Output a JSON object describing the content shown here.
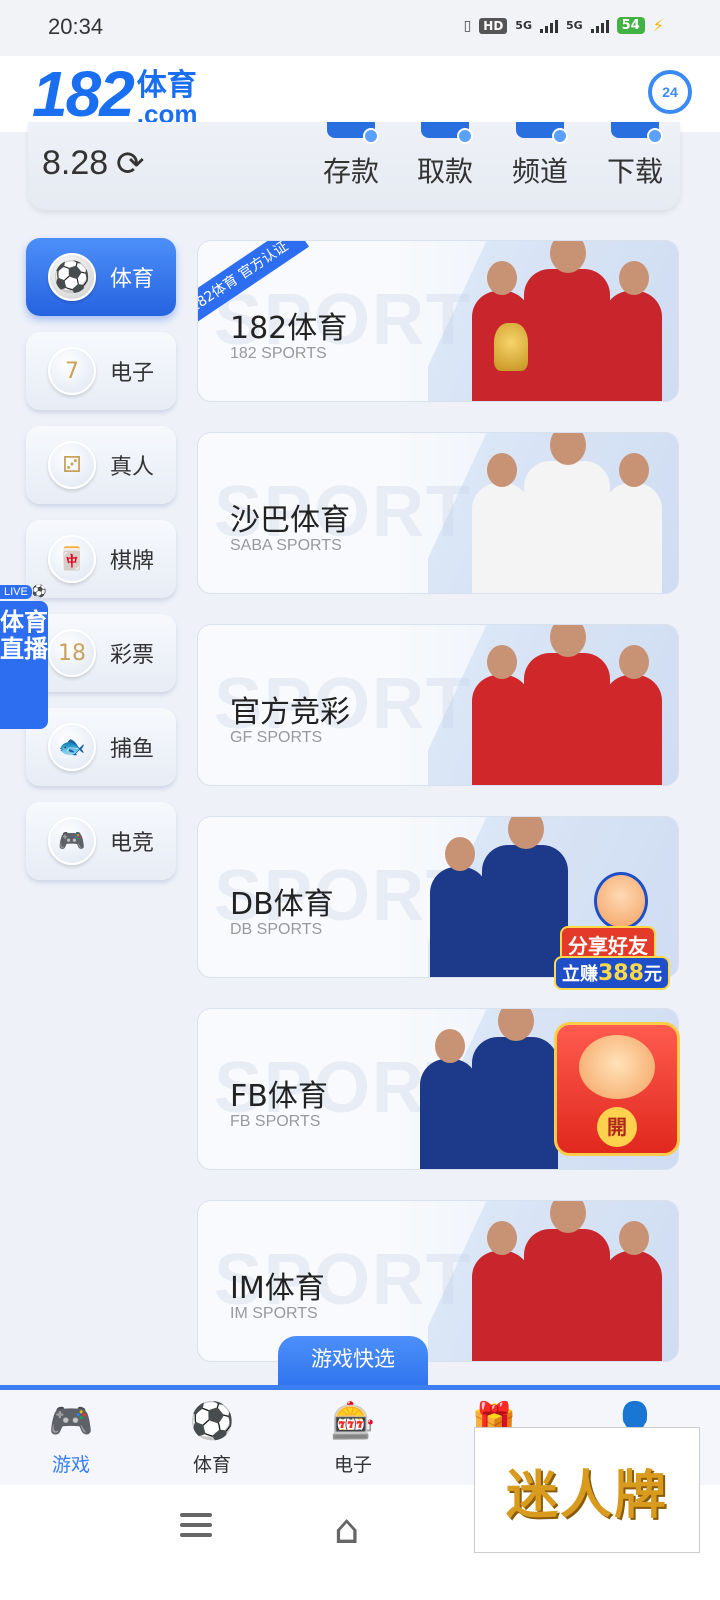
{
  "status_bar": {
    "time": "20:34",
    "hd": "HD",
    "sig1": "5G",
    "sig2": "5G",
    "battery": "54"
  },
  "header": {
    "logo_number": "182",
    "logo_text": "体育",
    "logo_domain": ".com",
    "support_label": "24"
  },
  "wallet": {
    "balance": "8.28",
    "actions": [
      {
        "label": "存款",
        "icon": "deposit-icon"
      },
      {
        "label": "取款",
        "icon": "withdraw-icon"
      },
      {
        "label": "频道",
        "icon": "channel-icon"
      },
      {
        "label": "下载",
        "icon": "download-icon"
      }
    ]
  },
  "categories": [
    {
      "label": "体育",
      "icon": "soccer-ball-icon",
      "glyph": "⚽",
      "active": true
    },
    {
      "label": "电子",
      "icon": "slot-machine-icon",
      "glyph": "7",
      "active": false
    },
    {
      "label": "真人",
      "icon": "dice-icon",
      "glyph": "⚂",
      "active": false
    },
    {
      "label": "棋牌",
      "icon": "mahjong-icon",
      "glyph": "🀄",
      "active": false
    },
    {
      "label": "彩票",
      "icon": "lottery-ball-icon",
      "glyph": "18",
      "active": false
    },
    {
      "label": "捕鱼",
      "icon": "fish-icon",
      "glyph": "🐟",
      "active": false
    },
    {
      "label": "电竞",
      "icon": "gamepad-icon",
      "glyph": "🎮",
      "active": false
    }
  ],
  "live_badge": {
    "tag": "LIVE",
    "text": "体育直播"
  },
  "games": [
    {
      "title": "182体育",
      "subtitle": "182 SPORTS",
      "bg_text": "SPORTS",
      "ribbon": "182体育 官方认证",
      "jersey": "#c8262c"
    },
    {
      "title": "沙巴体育",
      "subtitle": "SABA SPORTS",
      "bg_text": "SPORTS",
      "jersey": "#f4f4f4"
    },
    {
      "title": "官方竞彩",
      "subtitle": "GF SPORTS",
      "bg_text": "SPORTS",
      "jersey": "#d0282a"
    },
    {
      "title": "DB体育",
      "subtitle": "DB SPORTS",
      "bg_text": "SPORTS",
      "jersey": "#1d3a8a"
    },
    {
      "title": "FB体育",
      "subtitle": "FB SPORTS",
      "bg_text": "SPORTS",
      "jersey": "#1d3a8a"
    },
    {
      "title": "IM体育",
      "subtitle": "IM SPORTS",
      "bg_text": "SPORTS",
      "jersey": "#c8262c"
    }
  ],
  "promos": {
    "share_line1": "分享好友",
    "share_line2_prefix": "立赚",
    "share_amount": "388",
    "share_unit": "元",
    "envelope_text": "開"
  },
  "quick_select": "游戏快选",
  "bottom_nav": [
    {
      "label": "游戏",
      "icon": "gamepad-icon",
      "glyph": "🎮",
      "active": true
    },
    {
      "label": "体育",
      "icon": "soccer-ball-icon",
      "glyph": "⚽",
      "active": false
    },
    {
      "label": "电子",
      "icon": "slot-machine-icon",
      "glyph": "🎰",
      "active": false
    },
    {
      "label": "",
      "icon": "gift-icon",
      "glyph": "🎁",
      "active": false
    },
    {
      "label": "",
      "icon": "profile-icon",
      "glyph": "👤",
      "active": false
    }
  ],
  "overlay": {
    "text": "迷人牌"
  },
  "colors": {
    "brand_blue": "#1a6ff1",
    "accent_blue": "#3b7ef2"
  }
}
